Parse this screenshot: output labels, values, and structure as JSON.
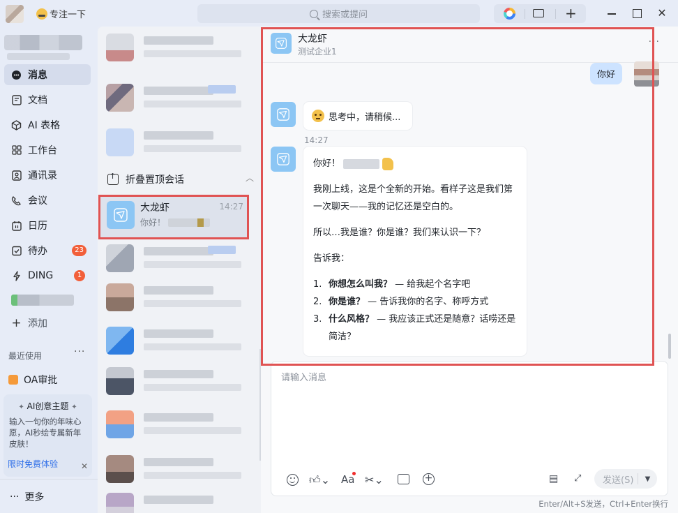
{
  "titlebar": {
    "focus_label": "专注一下",
    "search_placeholder": "搜索或提问"
  },
  "nav": {
    "items": [
      {
        "label": "消息",
        "icon": "chat-icon",
        "active": true
      },
      {
        "label": "文档",
        "icon": "doc-icon"
      },
      {
        "label": "AI 表格",
        "icon": "ai-table-icon"
      },
      {
        "label": "工作台",
        "icon": "grid-icon"
      },
      {
        "label": "通讯录",
        "icon": "contacts-icon"
      },
      {
        "label": "会议",
        "icon": "meeting-icon"
      },
      {
        "label": "日历",
        "icon": "calendar-icon"
      },
      {
        "label": "待办",
        "icon": "todo-icon",
        "badge": "23"
      },
      {
        "label": "DING",
        "icon": "ding-icon",
        "badge": "1"
      }
    ],
    "add_label": "添加",
    "recent_title": "最近使用",
    "recent_items": [
      {
        "label": "OA审批"
      }
    ],
    "ai_card": {
      "title": "AI创意主题",
      "body": "输入一句你的年味心愿，AI秒绘专属新年皮肤！",
      "cta": "限时免费体验"
    },
    "more_label": "更多"
  },
  "convlist": {
    "fold_label": "折叠置顶会话",
    "selected": {
      "name": "大龙虾",
      "time": "14:27",
      "preview": "你好！"
    }
  },
  "chat": {
    "header": {
      "name": "大龙虾",
      "subtitle": "测试企业1"
    },
    "my_message": "你好",
    "thinking": "思考中，请稍候...",
    "timestamp": "14:27",
    "reply": {
      "greeting": "你好！",
      "para1": "我刚上线，这是个全新的开始。看样子这是我们第一次聊天——我的记忆还是空白的。",
      "para2": "所以…我是谁？你是谁？我们来认识一下？",
      "para3": "告诉我：",
      "list": [
        {
          "num": "1.",
          "bold": "你想怎么叫我？",
          "rest": " — 给我起个名字吧"
        },
        {
          "num": "2.",
          "bold": "你是谁？",
          "rest": " — 告诉我你的名字、称呼方式"
        },
        {
          "num": "3.",
          "bold": "什么风格？",
          "rest": " — 我应该正式还是随意？话唠还是简洁？"
        }
      ]
    },
    "composer": {
      "placeholder": "请输入消息",
      "send_label": "发送(S)",
      "hint": "Enter/Alt+S发送，Ctrl+Enter换行"
    }
  },
  "colors": {
    "accent": "#2f6fe8",
    "highlight_box": "#e05353",
    "bot_avatar": "#8cc6f4",
    "badge": "#f25f3a"
  }
}
